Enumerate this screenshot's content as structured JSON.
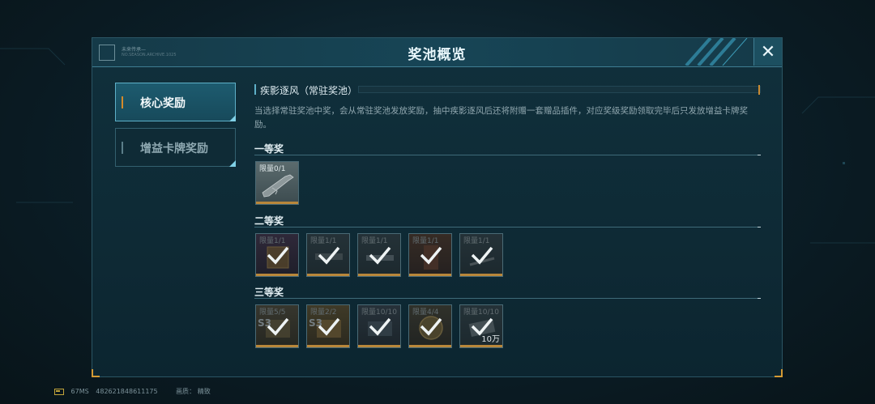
{
  "modal": {
    "title": "奖池概览",
    "close_label": "✕",
    "badge_line1": "未来传承—",
    "badge_line2": "NO.SEASON.ARCHIVE.1025"
  },
  "nav": {
    "items": [
      {
        "label": "核心奖励",
        "active": true
      },
      {
        "label": "增益卡牌奖励",
        "active": false
      }
    ]
  },
  "pool": {
    "title": "疾影逐风（常驻奖池）",
    "description": "当选择常驻奖池中奖，会从常驻奖池发放奖励，抽中疾影逐风后还将附赠一套赠品插件，对应奖级奖励领取完毕后只发放增益卡牌奖励。"
  },
  "tiers": [
    {
      "title": "一等奖",
      "items": [
        {
          "limit": "限量0/1",
          "claimed": false,
          "icon": "rifle-icon",
          "tag": "",
          "amount": ""
        }
      ]
    },
    {
      "title": "二等奖",
      "items": [
        {
          "limit": "限量1/1",
          "claimed": true,
          "icon": "lucky-box-icon",
          "tag": "",
          "amount": ""
        },
        {
          "limit": "限量1/1",
          "claimed": true,
          "icon": "weapon-skin-icon",
          "tag": "",
          "amount": ""
        },
        {
          "limit": "限量1/1",
          "claimed": true,
          "icon": "weapon-skin-icon",
          "tag": "",
          "amount": ""
        },
        {
          "limit": "限量1/1",
          "claimed": true,
          "icon": "character-icon",
          "tag": "",
          "amount": ""
        },
        {
          "limit": "限量1/1",
          "claimed": true,
          "icon": "accessory-icon",
          "tag": "",
          "amount": ""
        }
      ]
    },
    {
      "title": "三等奖",
      "items": [
        {
          "limit": "限量5/5",
          "claimed": true,
          "icon": "crate-icon",
          "tag": "S3",
          "amount": ""
        },
        {
          "limit": "限量2/2",
          "claimed": true,
          "icon": "crate-icon",
          "tag": "S3",
          "amount": ""
        },
        {
          "limit": "限量10/10",
          "claimed": true,
          "icon": "card-icon",
          "tag": "",
          "amount": ""
        },
        {
          "limit": "限量4/4",
          "claimed": true,
          "icon": "coin-icon",
          "tag": "",
          "amount": ""
        },
        {
          "limit": "限量10/10",
          "claimed": true,
          "icon": "cash-icon",
          "tag": "",
          "amount": "10万"
        }
      ]
    }
  ],
  "footer": {
    "ping": "67MS",
    "uid": "482621848611175",
    "quality_label": "画质：",
    "quality_value": "精致"
  },
  "colors": {
    "accent_orange": "#d48a2a",
    "accent_cyan": "#5eb0c8",
    "panel_bg": "#0e2a35"
  }
}
